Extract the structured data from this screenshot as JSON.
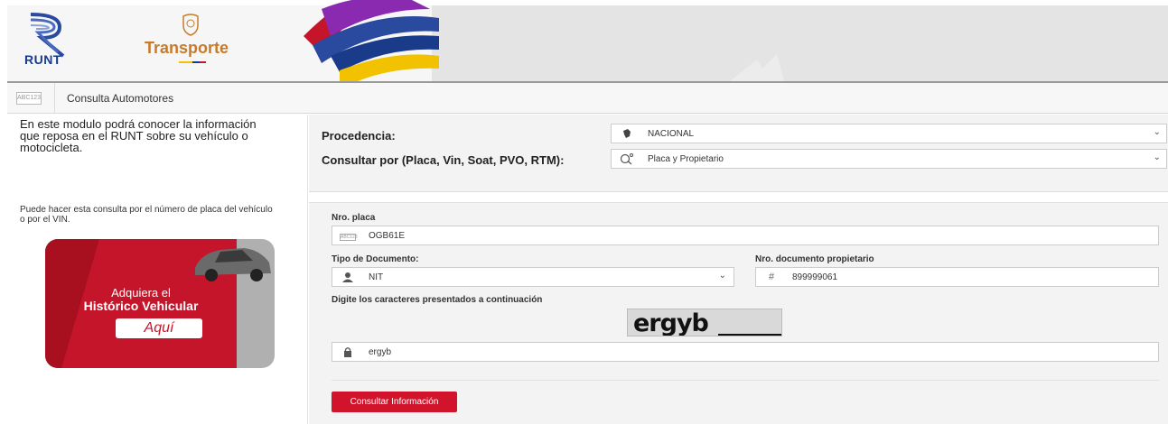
{
  "header": {
    "runt_logo_text": "RUNT",
    "transporte_logo_text": "Transporte"
  },
  "breadcrumb": {
    "icon_text": "ABC123",
    "title": "Consulta Automotores"
  },
  "left": {
    "intro": "En este modulo podrá conocer la información que reposa en el RUNT sobre su vehículo o motocicleta.",
    "hint": "Puede hacer esta consulta por el número de placa del vehículo o por el VIN.",
    "promo": {
      "line1": "Adquiera el",
      "line2": "Histórico Vehicular",
      "button": "Aquí"
    }
  },
  "filters": {
    "procedencia_label": "Procedencia:",
    "procedencia_value": "NACIONAL",
    "consultar_label": "Consultar por (Placa, Vin, Soat, PVO, RTM):",
    "consultar_value": "Placa y Propietario"
  },
  "form": {
    "placa_label": "Nro. placa",
    "placa_icon_text": "ABC123",
    "placa_value": "OGB61E",
    "tipo_doc_label": "Tipo de Documento:",
    "tipo_doc_value": "NIT",
    "nro_doc_label": "Nro. documento propietario",
    "nro_doc_value": "899999061",
    "captcha_label": "Digite los caracteres presentados a continuación",
    "captcha_image_text": "ergyb",
    "captcha_value": "ergyb",
    "submit_label": "Consultar Información"
  },
  "colors": {
    "brand_red": "#d1142b",
    "runt_blue": "#1a3a8a",
    "transporte_orange": "#c77b2a"
  }
}
